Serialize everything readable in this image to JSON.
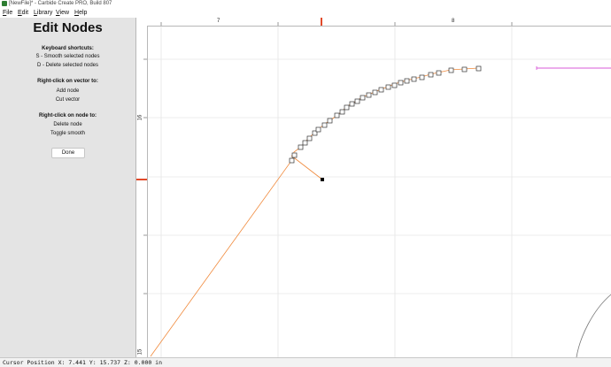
{
  "window": {
    "title": "[NewFile]* - Carbide Create PRO, Build 807"
  },
  "menu": [
    "File",
    "Edit",
    "Library",
    "View",
    "Help"
  ],
  "panel": {
    "title": "Edit Nodes",
    "keyboard_heading": "Keyboard shortcuts:",
    "keyboard_items": [
      "S - Smooth selected nodes",
      "D - Delete selected nodes"
    ],
    "vector_heading": "Right-click on vector to:",
    "vector_items": [
      "Add node",
      "Cut vector"
    ],
    "node_heading": "Right-click on node to:",
    "node_items": [
      "Delete node",
      "Toggle smooth"
    ],
    "done_label": "Done"
  },
  "rulers": {
    "horizontal_labels": [
      "7",
      "8"
    ],
    "vertical_labels": [
      "16",
      "15"
    ]
  },
  "colors": {
    "path": "#f08a3c",
    "marker": "#e24a2a",
    "magenta": "#d85ad8",
    "grid": "#dddddd",
    "panel_bg": "#e4e4e4"
  },
  "status": {
    "cursor_text": "Cursor Position X: 7.441 Y: 15.737 Z: 0.000 in"
  }
}
